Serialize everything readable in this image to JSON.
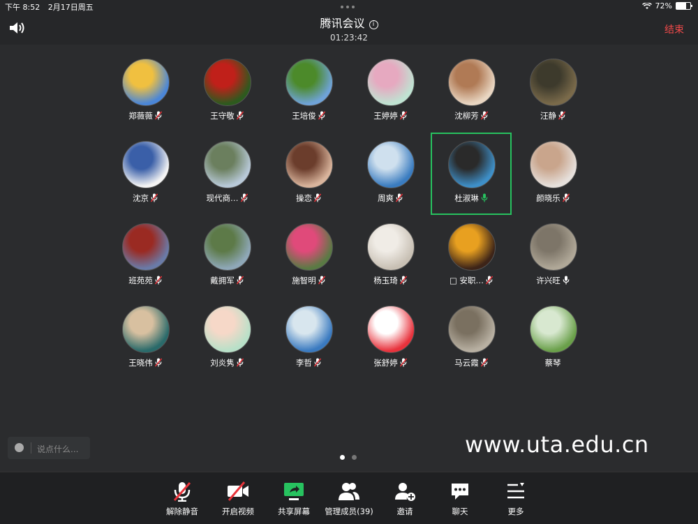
{
  "status": {
    "time": "下午 8:52",
    "date": "2月17日周五",
    "battery": "72%",
    "battery_level": 0.72
  },
  "header": {
    "title": "腾讯会议",
    "timer": "01:23:42",
    "end_label": "结束"
  },
  "participants": [
    {
      "name": "郑薇薇",
      "mic": "muted",
      "avatar": "cartoon-girl",
      "colors": [
        "#4a86d8",
        "#f0c040"
      ]
    },
    {
      "name": "王守敬",
      "mic": "muted",
      "avatar": "berries",
      "colors": [
        "#2d5a1e",
        "#c0201a"
      ]
    },
    {
      "name": "王培俊",
      "mic": "muted",
      "avatar": "landscape",
      "colors": [
        "#6fa3d8",
        "#4c8a2a"
      ]
    },
    {
      "name": "王婷婷",
      "mic": "muted",
      "avatar": "candy",
      "colors": [
        "#bfe3d2",
        "#e6a9c0"
      ]
    },
    {
      "name": "沈柳芳",
      "mic": "muted",
      "avatar": "child-photo",
      "colors": [
        "#e9d6c2",
        "#b07a55"
      ]
    },
    {
      "name": "汪静",
      "mic": "muted",
      "avatar": "koala",
      "colors": [
        "#7a6a4a",
        "#3d3a2c"
      ]
    },
    {
      "name": "沈京",
      "mic": "muted",
      "avatar": "sketch",
      "colors": [
        "#f4f4f4",
        "#3a5fa8"
      ]
    },
    {
      "name": "现代商…",
      "mic": "muted",
      "avatar": "lake",
      "colors": [
        "#b8c9d8",
        "#6b7f5e"
      ]
    },
    {
      "name": "操恋",
      "mic": "muted",
      "avatar": "portrait",
      "colors": [
        "#d9b49c",
        "#6b3d2c"
      ]
    },
    {
      "name": "周爽",
      "mic": "muted",
      "avatar": "sea",
      "colors": [
        "#3a7cc0",
        "#cfe0ee"
      ]
    },
    {
      "name": "杜淑琳",
      "mic": "active",
      "avatar": "woman-portrait",
      "colors": [
        "#3e8fc8",
        "#2a2a2a"
      ]
    },
    {
      "name": "颜晓乐",
      "mic": "muted",
      "avatar": "baby",
      "colors": [
        "#e6e0dc",
        "#c9a58c"
      ]
    },
    {
      "name": "班苑苑",
      "mic": "muted",
      "avatar": "costume",
      "colors": [
        "#6a7ba8",
        "#9a2a22"
      ]
    },
    {
      "name": "戴拥军",
      "mic": "muted",
      "avatar": "willow",
      "colors": [
        "#8fa8b8",
        "#5d7a48"
      ]
    },
    {
      "name": "施智明",
      "mic": "muted",
      "avatar": "flowers",
      "colors": [
        "#5a7a44",
        "#e04a7a"
      ]
    },
    {
      "name": "杨玉琦",
      "mic": "muted",
      "avatar": "dog",
      "colors": [
        "#c8c0b4",
        "#f0ece6"
      ]
    },
    {
      "name": "安职…",
      "mic": "muted",
      "prefix": "□",
      "avatar": "sunflower-girl",
      "colors": [
        "#3d2418",
        "#e8a020"
      ]
    },
    {
      "name": "许兴旺",
      "mic": "on",
      "avatar": "number-16",
      "colors": [
        "#b0a898",
        "#7d7568"
      ]
    },
    {
      "name": "王晓伟",
      "mic": "muted",
      "avatar": "boy",
      "colors": [
        "#2a6a6a",
        "#d8c0a0"
      ]
    },
    {
      "name": "刘炎隽",
      "mic": "muted",
      "avatar": "cartoon-face",
      "colors": [
        "#b8e0c8",
        "#f6d8c8"
      ]
    },
    {
      "name": "李哲",
      "mic": "muted",
      "avatar": "beach",
      "colors": [
        "#3a7ac0",
        "#d8e6ee"
      ]
    },
    {
      "name": "张舒婷",
      "mic": "muted",
      "avatar": "pig-cartoon",
      "colors": [
        "#e8323c",
        "#ffffff"
      ]
    },
    {
      "name": "马云霞",
      "mic": "muted",
      "avatar": "tree",
      "colors": [
        "#b8b0a2",
        "#7a7060"
      ]
    },
    {
      "name": "蔡琴",
      "mic": "none",
      "avatar": "garden",
      "colors": [
        "#6aa04a",
        "#d8e8d0"
      ]
    }
  ],
  "chat": {
    "placeholder": "说点什么..."
  },
  "watermark": "www.uta.edu.cn",
  "pager": {
    "pages": 2,
    "current": 1
  },
  "toolbar": [
    {
      "label": "解除静音",
      "icon": "mic-muted-icon"
    },
    {
      "label": "开启视频",
      "icon": "video-off-icon"
    },
    {
      "label": "共享屏幕",
      "icon": "share-screen-icon"
    },
    {
      "label": "管理成员(39)",
      "icon": "members-icon"
    },
    {
      "label": "邀请",
      "icon": "invite-icon"
    },
    {
      "label": "聊天",
      "icon": "chat-icon"
    },
    {
      "label": "更多",
      "icon": "more-icon"
    }
  ],
  "colors": {
    "accent_green": "#27c25f",
    "end_red": "#f24a4a",
    "mute_red": "#e8333a"
  }
}
